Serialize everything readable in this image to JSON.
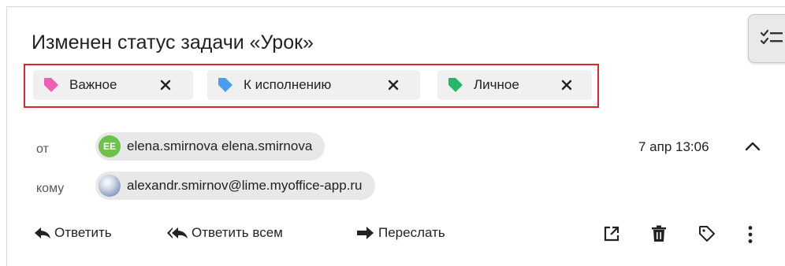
{
  "message": {
    "subject": "Изменен статус задачи «Урок»",
    "tags": [
      {
        "label": "Важное",
        "color": "#f15fb4"
      },
      {
        "label": "К исполнению",
        "color": "#4b9cf0"
      },
      {
        "label": "Личное",
        "color": "#25b86a"
      }
    ],
    "from_label": "от",
    "from": {
      "initials": "EE",
      "name": "elena.smirnova elena.smirnova"
    },
    "to_label": "кому",
    "to": {
      "address": "alexandr.smirnov@lime.myoffice-app.ru"
    },
    "date": "7 апр 13:06"
  },
  "actions": {
    "reply": "Ответить",
    "reply_all": "Ответить всем",
    "forward": "Переслать"
  },
  "colors": {
    "highlight_border": "#e0252f",
    "avatar_initials_bg": "#6cc24a"
  },
  "icons": [
    "checklist-icon",
    "tag-icon",
    "close-icon",
    "chevron-up-icon",
    "reply-icon",
    "reply-all-icon",
    "forward-icon",
    "open-external-icon",
    "trash-icon",
    "tag-outline-icon",
    "more-vertical-icon"
  ]
}
